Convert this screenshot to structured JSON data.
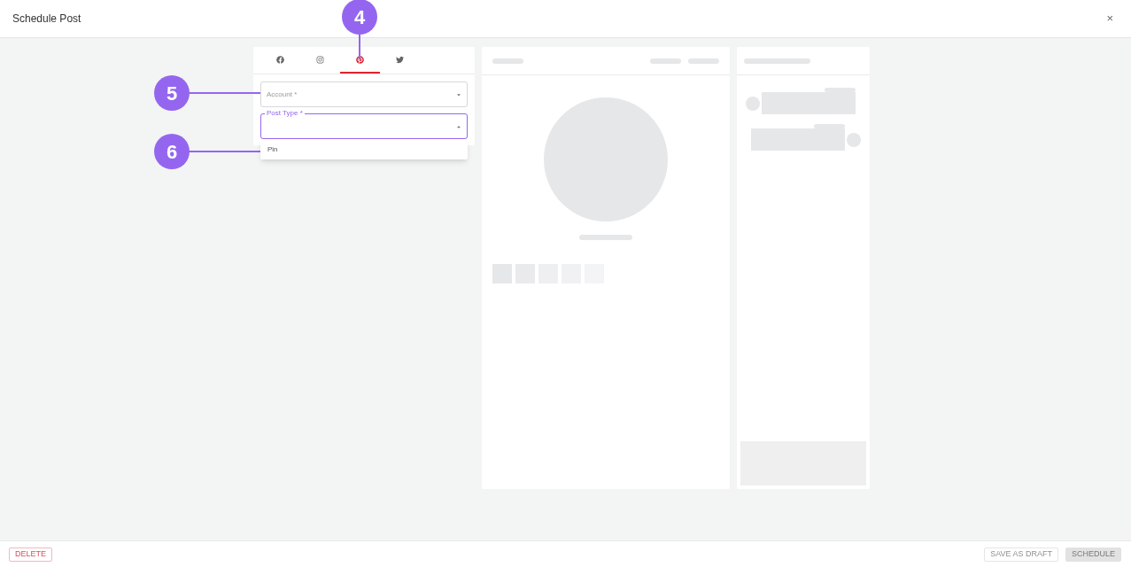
{
  "window": {
    "title": "Schedule Post",
    "close": "×"
  },
  "tabs": [
    {
      "kind": "facebook",
      "selected": false
    },
    {
      "kind": "instagram",
      "selected": false
    },
    {
      "kind": "pinterest",
      "selected": true
    },
    {
      "kind": "twitter",
      "selected": false
    }
  ],
  "account_field": {
    "placeholder": "Account *",
    "focused": false
  },
  "post_type_field": {
    "label": "Post Type *",
    "focused": true,
    "expanded": true,
    "options": [
      "Pin"
    ]
  },
  "callouts": [
    "4",
    "5",
    "6"
  ],
  "footer": {
    "delete": {
      "label": "DELETE"
    },
    "save_draft": {
      "label": "SAVE AS DRAFT",
      "disabled": true
    },
    "schedule": {
      "label": "SCHEDULE",
      "disabled": true
    }
  }
}
